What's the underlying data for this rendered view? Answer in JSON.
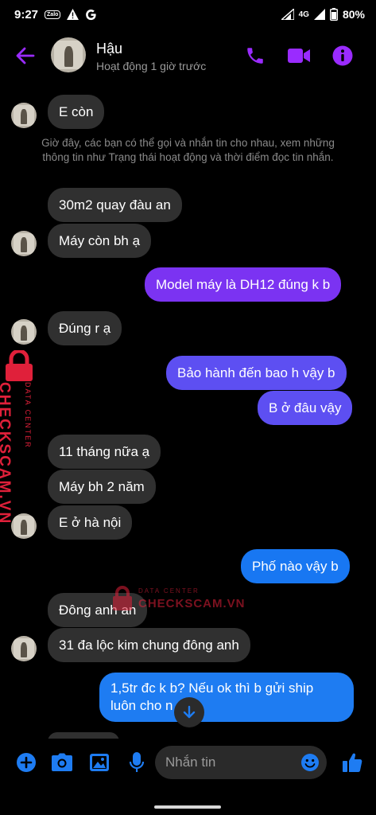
{
  "status_bar": {
    "time": "9:27",
    "app_icon": "Zalo",
    "network": "4G",
    "battery": "80%"
  },
  "header": {
    "name": "Hậu",
    "status": "Hoạt động 1 giờ trước"
  },
  "conversation": {
    "info_text": "Giờ đây, các bạn có thể gọi và nhắn tin cho nhau, xem những thông tin như Trạng thái hoạt động và thời điểm đọc tin nhắn.",
    "messages": [
      {
        "from": "them",
        "text": "E còn"
      },
      {
        "from": "them",
        "text": "30m2 quay đàu an"
      },
      {
        "from": "them",
        "text": "Máy còn bh ạ"
      },
      {
        "from": "me",
        "text": "Model máy là DH12 đúng k b"
      },
      {
        "from": "them",
        "text": "Đúng r ạ"
      },
      {
        "from": "me",
        "text": "Bảo hành đến bao h vậy b"
      },
      {
        "from": "me",
        "text": "B ở đâu vậy"
      },
      {
        "from": "them",
        "text": "11 tháng nữa ạ"
      },
      {
        "from": "them",
        "text": "Máy bh 2 năm"
      },
      {
        "from": "them",
        "text": "E ở hà nội"
      },
      {
        "from": "me",
        "text": "Phố nào vậy b"
      },
      {
        "from": "them",
        "text": "Đông anh an"
      },
      {
        "from": "them",
        "text": "31 đa lộc kim chung đông anh"
      },
      {
        "from": "me",
        "text": "1,5tr đc k b? Nếu ok thì b gửi ship luôn cho n"
      }
    ]
  },
  "watermark": {
    "side_brand": "CHECKSCAM.VN",
    "side_sub": "DATA CENTER",
    "center_sub": "DATA CENTER",
    "center_brand": "CHECKSCAM.VN"
  },
  "composer": {
    "placeholder": "Nhắn tin"
  },
  "colors": {
    "accent": "#9a2bff",
    "bubble_in": "#303030",
    "bubble_out_purple": "#7b33f2",
    "bubble_out_blue": "#1877f2",
    "composer_blue": "#1e7cf2",
    "watermark_red": "#e0203a"
  }
}
